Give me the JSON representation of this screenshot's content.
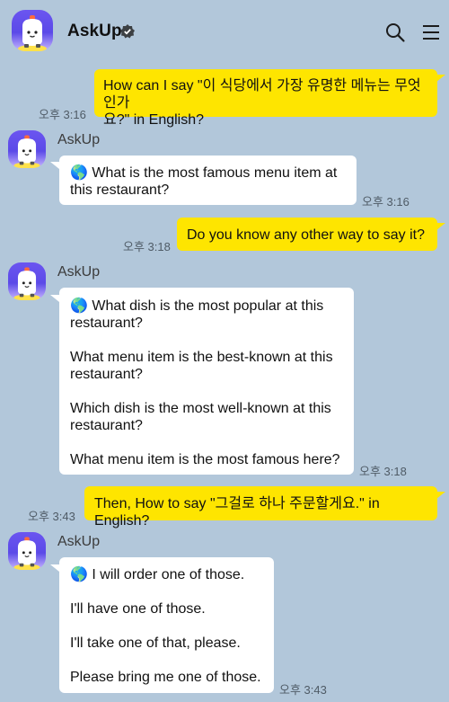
{
  "header": {
    "title": "AskUp"
  },
  "icons": {
    "avatar": "askup-robot-avatar",
    "verified": "verified-badge-icon",
    "search": "search-icon",
    "menu": "hamburger-menu-icon",
    "globe": "globe-emoji"
  },
  "colors": {
    "background": "#b2c7da",
    "user_bubble": "#fee500",
    "bot_bubble": "#ffffff"
  },
  "messages": [
    {
      "from": "user",
      "text": "How can I say \"이 식당에서 가장 유명한 메뉴는 무엇인가\n요?\" in English?",
      "time": "오후 3:16"
    },
    {
      "from": "bot",
      "sender": "AskUp",
      "text": "🌎 What is the most famous menu item at\nthis restaurant?",
      "time": "오후 3:16"
    },
    {
      "from": "user",
      "text": "Do you know any other way to say it?",
      "time": "오후 3:18"
    },
    {
      "from": "bot",
      "sender": "AskUp",
      "paragraphs": [
        "🌎 What dish is the most popular at this\nrestaurant?",
        "What menu item is the best-known at this\nrestaurant?",
        "Which dish is the most well-known at this\nrestaurant?",
        "What menu item is the most famous here?"
      ],
      "time": "오후 3:18"
    },
    {
      "from": "user",
      "text": "Then, How to say \"그걸로 하나 주문할게요.\" in English?",
      "time": "오후 3:43"
    },
    {
      "from": "bot",
      "sender": "AskUp",
      "paragraphs": [
        "🌎 I will order one of those.",
        "I'll have one of those.",
        "I'll take one of that, please.",
        "Please bring me one of those."
      ],
      "time": "오후 3:43"
    }
  ]
}
